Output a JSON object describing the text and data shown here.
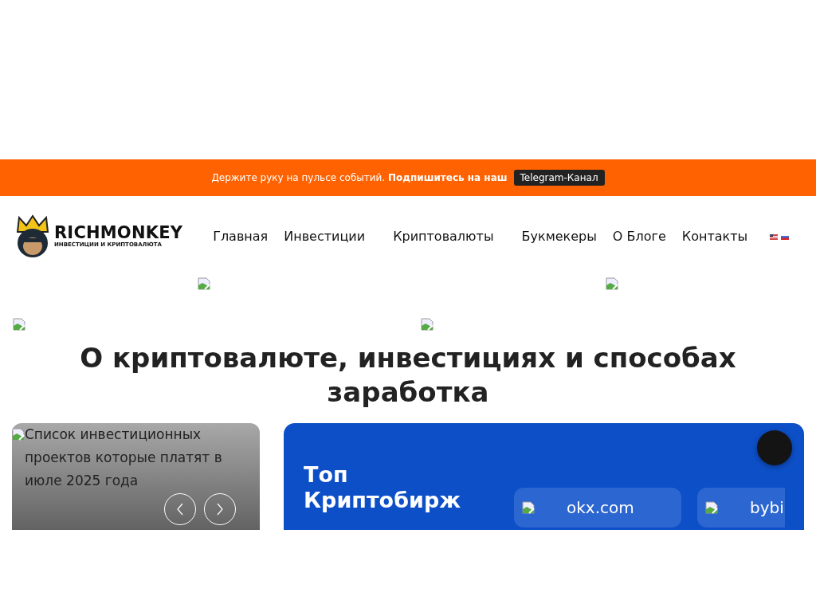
{
  "topbar": {
    "text": "Держите руку на пульсе событий. **Подпишитесь на наш**",
    "button": "Telegram-Канал"
  },
  "logo": {
    "name": "RICHMONKEY",
    "tagline": "ИНВЕСТИЦИИ И КРИПТОВАЛЮТА"
  },
  "nav": [
    {
      "label": "Главная"
    },
    {
      "label": "Инвестиции"
    },
    {
      "label": "Криптовалюты"
    },
    {
      "label": "Букмекеры"
    },
    {
      "label": "О Блоге"
    },
    {
      "label": "Контакты"
    }
  ],
  "heading": "О криптовалюте, инвестициях и способах заработка",
  "post": {
    "alt": "Список инвестиционных проектов которые платят в июле 2025 года"
  },
  "exchanges_card": {
    "title": "Топ Криптобирж",
    "exchanges": [
      "okx.com",
      "bybi"
    ]
  }
}
